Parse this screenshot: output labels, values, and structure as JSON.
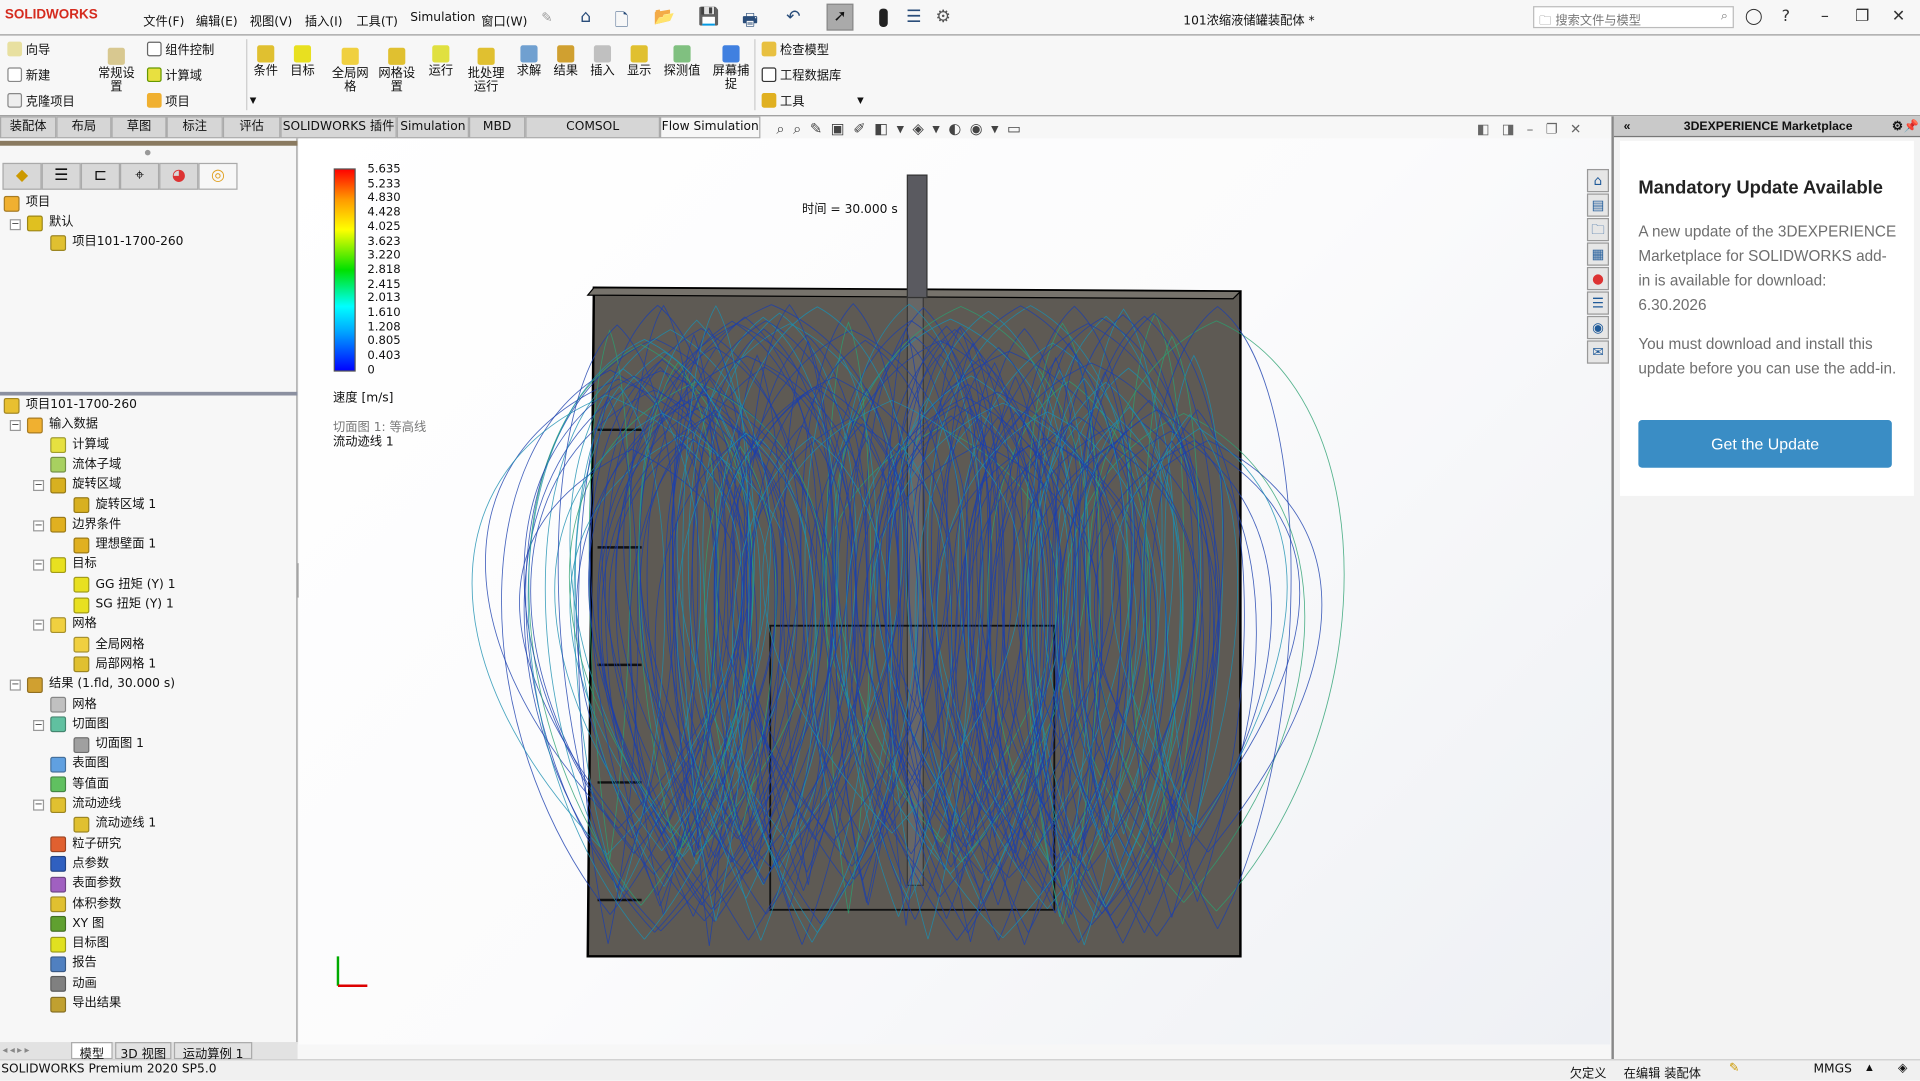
{
  "app": {
    "logo": "SOLIDWORKS",
    "title": "101浓缩液储罐装配体 *",
    "search_placeholder": "搜索文件与模型"
  },
  "menu": [
    "文件(F)",
    "编辑(E)",
    "视图(V)",
    "插入(I)",
    "工具(T)",
    "Simulation",
    "窗口(W)"
  ],
  "ribbon": {
    "col1": [
      "向导",
      "新建",
      "克隆项目"
    ],
    "general": "常规设置",
    "col2": [
      "组件控制",
      "计算域",
      "项目"
    ],
    "big": [
      "条件",
      "目标",
      "全局网格",
      "网格设置",
      "运行",
      "批处理运行",
      "求解",
      "结果",
      "插入",
      "显示",
      "探测值",
      "屏幕捕捉"
    ],
    "col3": [
      "检查模型",
      "工程数据库",
      "工具"
    ]
  },
  "tabs": [
    "装配体",
    "布局",
    "草图",
    "标注",
    "评估",
    "SOLIDWORKS 插件",
    "Simulation",
    "MBD",
    "COMSOL Multiphysics",
    "Flow Simulation"
  ],
  "active_tab": "Flow Simulation",
  "project_tree": {
    "root": "项目",
    "config": "默认",
    "project": "项目101-1700-260"
  },
  "tree": [
    {
      "label": "项目101-1700-260",
      "depth": 0,
      "color": "#e8c030"
    },
    {
      "label": "输入数据",
      "depth": 1,
      "exp": true,
      "color": "#f0b030"
    },
    {
      "label": "计算域",
      "depth": 2,
      "color": "#e6e040"
    },
    {
      "label": "流体子域",
      "depth": 2,
      "color": "#a8d060"
    },
    {
      "label": "旋转区域",
      "depth": 2,
      "exp": true,
      "color": "#d8b020"
    },
    {
      "label": "旋转区域 1",
      "depth": 3,
      "color": "#d8b020"
    },
    {
      "label": "边界条件",
      "depth": 2,
      "exp": true,
      "color": "#e0b020"
    },
    {
      "label": "理想壁面 1",
      "depth": 3,
      "color": "#e0b020"
    },
    {
      "label": "目标",
      "depth": 2,
      "exp": true,
      "color": "#e8e020"
    },
    {
      "label": "GG 扭矩 (Y) 1",
      "depth": 3,
      "color": "#e8e020"
    },
    {
      "label": "SG 扭矩 (Y) 1",
      "depth": 3,
      "color": "#e8e020"
    },
    {
      "label": "网格",
      "depth": 2,
      "exp": true,
      "color": "#f0d040"
    },
    {
      "label": "全局网格",
      "depth": 3,
      "color": "#f0d040"
    },
    {
      "label": "局部网格 1",
      "depth": 3,
      "color": "#e0c030"
    },
    {
      "label": "结果 (1.fld, 30.000 s)",
      "depth": 1,
      "exp": true,
      "color": "#d0a030"
    },
    {
      "label": "网格",
      "depth": 2,
      "color": "#c0c0c0"
    },
    {
      "label": "切面图",
      "depth": 2,
      "exp": true,
      "color": "#60c0a0"
    },
    {
      "label": "切面图 1",
      "depth": 3,
      "color": "#a0a0a0"
    },
    {
      "label": "表面图",
      "depth": 2,
      "color": "#60a0e0"
    },
    {
      "label": "等值面",
      "depth": 2,
      "color": "#60c060"
    },
    {
      "label": "流动迹线",
      "depth": 2,
      "exp": true,
      "color": "#e0c030"
    },
    {
      "label": "流动迹线 1",
      "depth": 3,
      "color": "#e0c030"
    },
    {
      "label": "粒子研究",
      "depth": 2,
      "color": "#e06030"
    },
    {
      "label": "点参数",
      "depth": 2,
      "color": "#3060c0"
    },
    {
      "label": "表面参数",
      "depth": 2,
      "color": "#a060c0"
    },
    {
      "label": "体积参数",
      "depth": 2,
      "color": "#e0c030"
    },
    {
      "label": "XY 图",
      "depth": 2,
      "color": "#60a030"
    },
    {
      "label": "目标图",
      "depth": 2,
      "color": "#e0e020"
    },
    {
      "label": "报告",
      "depth": 2,
      "color": "#5080c0"
    },
    {
      "label": "动画",
      "depth": 2,
      "color": "#808080"
    },
    {
      "label": "导出结果",
      "depth": 2,
      "color": "#c0a030"
    }
  ],
  "viewport": {
    "legend_values": [
      "5.635",
      "5.233",
      "4.830",
      "4.428",
      "4.025",
      "3.623",
      "3.220",
      "2.818",
      "2.415",
      "2.013",
      "1.610",
      "1.208",
      "0.805",
      "0.403",
      "0"
    ],
    "legend_unit": "速度 [m/s]",
    "cut_plot": "切面图 1: 等高线",
    "flow_traj": "流动迹线 1",
    "time": "时间 = 30.000 s",
    "streamline_color": "#1a3fae"
  },
  "marketplace": {
    "header": "3DEXPERIENCE Marketplace",
    "title": "Mandatory Update Available",
    "p1": "A new update of the 3DEXPERIENCE Marketplace for SOLIDWORKS add-in is available for download: 6.30.2026",
    "p2": "You must download and install this update before you can use the add-in.",
    "button": "Get the Update",
    "button_color": "#3a8dc5"
  },
  "bottom_tabs": [
    "模型",
    "3D 视图",
    "运动算例 1"
  ],
  "status": {
    "version": "SOLIDWORKS Premium 2020 SP5.0",
    "defined": "欠定义",
    "editing": "在编辑 装配体",
    "units": "MMGS"
  }
}
